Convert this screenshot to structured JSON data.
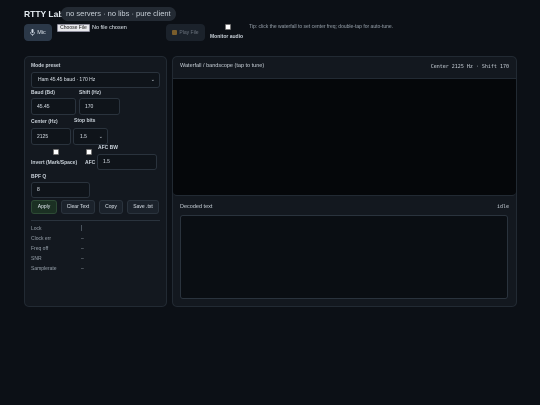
{
  "header": {
    "title": "RTTY Lab",
    "pill": "no servers · no libs · pure client",
    "mic_label": "Mic",
    "file_button": "Choose File",
    "file_status": "No file chosen",
    "play_label": "Play File",
    "monitor_label": "Monitor audio",
    "tip": "Tip: click the waterfall to set center freq; double-tap for auto-tune."
  },
  "controls": {
    "mode_label": "Mode preset",
    "mode_value": "Ham 45.45 baud · 170 Hz",
    "baud_label": "Baud (Bd)",
    "baud_value": "45.45",
    "shift_label": "Shift (Hz)",
    "shift_value": "170",
    "center_label": "Center (Hz)",
    "center_value": "2125",
    "stopbits_label": "Stop bits",
    "stopbits_value": "1.5",
    "afcbw_label": "AFC BW",
    "afcbw_value": "1.5",
    "invert_label": "Invert (Mark/Space)",
    "afc_label": "AFC",
    "bpfq_label": "BPF Q",
    "bpfq_value": "8",
    "apply": "Apply",
    "clear": "Clear Text",
    "copy": "Copy",
    "save": "Save .txt"
  },
  "stats": [
    {
      "label": "Lock",
      "value": ""
    },
    {
      "label": "Clock err",
      "value": "–"
    },
    {
      "label": "Freq off",
      "value": "–"
    },
    {
      "label": "SNR",
      "value": "–"
    },
    {
      "label": "Samplerate",
      "value": "–"
    }
  ],
  "waterfall": {
    "title": "Waterfall / bandscope (tap to tune)",
    "info": "Center 2125 Hz · Shift 170"
  },
  "decoded": {
    "title": "Decoded text",
    "status": "idle",
    "text": ""
  },
  "colors": {
    "background": "#0c1016",
    "panel": "#13181f",
    "accent_apply": "#1b3023"
  }
}
